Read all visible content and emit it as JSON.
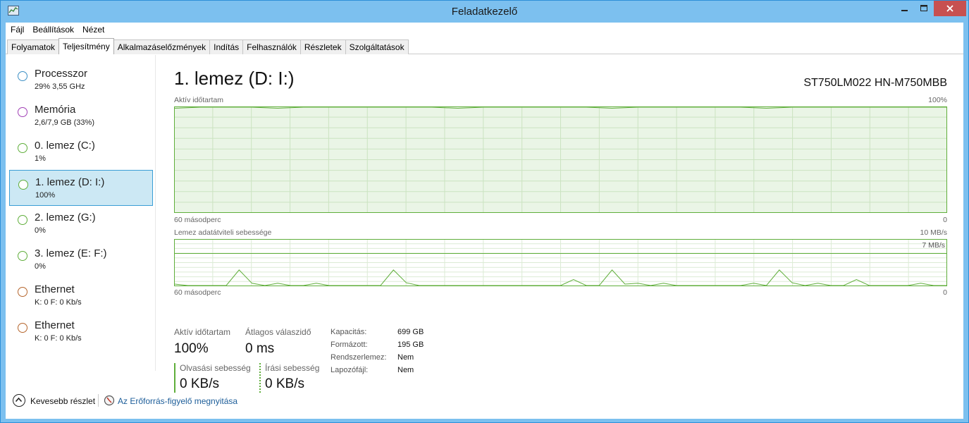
{
  "window": {
    "title": "Feladatkezelő"
  },
  "menu": [
    "Fájl",
    "Beállítások",
    "Nézet"
  ],
  "tabs": [
    "Folyamatok",
    "Teljesítmény",
    "Alkalmazáselőzmények",
    "Indítás",
    "Felhasználók",
    "Részletek",
    "Szolgáltatások"
  ],
  "active_tab": "Teljesítmény",
  "sidebar": {
    "items": [
      {
        "title": "Processzor",
        "sub": "29%  3,55 GHz",
        "color": "#3c8fc4"
      },
      {
        "title": "Memória",
        "sub": "2,6/7,9 GB (33%)",
        "color": "#a03fb5"
      },
      {
        "title": "0. lemez (C:)",
        "sub": "1%",
        "color": "#5fae3a"
      },
      {
        "title": "1. lemez (D: I:)",
        "sub": "100%",
        "color": "#5fae3a",
        "selected": true
      },
      {
        "title": "2. lemez (G:)",
        "sub": "0%",
        "color": "#5fae3a"
      },
      {
        "title": "3. lemez (E: F:)",
        "sub": "0%",
        "color": "#5fae3a"
      },
      {
        "title": "Ethernet",
        "sub": "K: 0  F: 0 Kb/s",
        "color": "#b5652c"
      },
      {
        "title": "Ethernet",
        "sub": "K: 0  F: 0 Kb/s",
        "color": "#b5652c"
      }
    ]
  },
  "detail": {
    "title": "1. lemez (D: I:)",
    "model": "ST750LM022 HN-M750MBB",
    "chart_active": {
      "label": "Aktív időtartam",
      "max_label": "100%",
      "time_label": "60 másodperc",
      "zero_label": "0"
    },
    "chart_transfer": {
      "label": "Lemez adatátviteli sebessége",
      "max_label": "10 MB/s",
      "line_label": "7 MB/s",
      "time_label": "60 másodperc",
      "zero_label": "0"
    },
    "stats": {
      "active_label": "Aktív időtartam",
      "active_value": "100%",
      "resp_label": "Átlagos válaszidő",
      "resp_value": "0 ms",
      "read_label": "Olvasási sebesség",
      "read_value": "0 KB/s",
      "write_label": "Írási sebesség",
      "write_value": "0 KB/s"
    },
    "props": [
      {
        "label": "Kapacitás:",
        "value": "699 GB"
      },
      {
        "label": "Formázott:",
        "value": "195 GB"
      },
      {
        "label": "Rendszerlemez:",
        "value": "Nem"
      },
      {
        "label": "Lapozófájl:",
        "value": "Nem"
      }
    ]
  },
  "footer": {
    "fewer_details": "Kevesebb részlet",
    "resmon_link": "Az Erőforrás-figyelő megnyitása"
  },
  "chart_data": [
    {
      "type": "area",
      "title": "Aktív időtartam",
      "xlabel": "60 másodperc",
      "ylim": [
        0,
        100
      ],
      "series": [
        {
          "values": [
            99,
            100,
            100,
            100,
            99,
            100,
            100,
            100,
            100,
            100,
            100,
            99,
            100,
            100,
            100,
            100,
            100,
            99,
            100,
            100,
            100,
            100,
            100,
            99,
            100,
            100,
            100,
            100,
            100,
            100,
            100
          ]
        }
      ]
    },
    {
      "type": "line",
      "title": "Lemez adatátviteli sebessége",
      "xlabel": "60 másodperc",
      "ylim": [
        0,
        10
      ],
      "series": [
        {
          "values": [
            0.3,
            0,
            0,
            0,
            0,
            3.4,
            0.5,
            0,
            0.5,
            0,
            0,
            0.5,
            0,
            0,
            0,
            0,
            0,
            3.4,
            0.6,
            0,
            0,
            0,
            0,
            0,
            0,
            0,
            0,
            0,
            0,
            0,
            0,
            1.3,
            0,
            0,
            3.4,
            0.3,
            0.5,
            0,
            0.5,
            0,
            0,
            0,
            0,
            0,
            0,
            0.5,
            0,
            3.4,
            0.6,
            0,
            0.5,
            0,
            0,
            1.3,
            0,
            0,
            0,
            0,
            0.5,
            0,
            0
          ]
        }
      ]
    }
  ]
}
